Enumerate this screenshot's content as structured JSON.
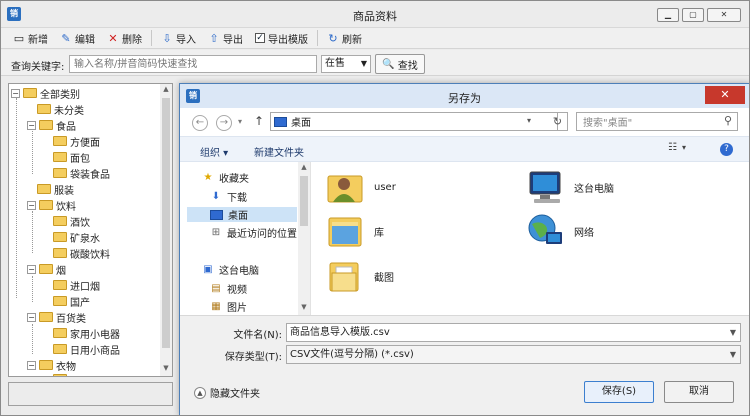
{
  "app": {
    "icon_text": "销",
    "title": "商品资料"
  },
  "toolbar": [
    {
      "label": "新增",
      "icon": "new-doc-icon"
    },
    {
      "label": "编辑",
      "icon": "pencil-icon"
    },
    {
      "label": "删除",
      "icon": "delete-x-icon"
    },
    {
      "label": "导入",
      "icon": "import-icon"
    },
    {
      "label": "导出",
      "icon": "export-icon"
    },
    {
      "label": "导出模版",
      "icon": "checkbox-icon"
    },
    {
      "label": "刷新",
      "icon": "refresh-icon"
    }
  ],
  "search": {
    "label": "查询关键字:",
    "placeholder": "输入名称/拼音简码快速查找",
    "status_value": "在售",
    "button": "查找"
  },
  "tree": [
    "全部类别",
    "未分类",
    "食品",
    "方便面",
    "面包",
    "袋装食品",
    "服装",
    "饮料",
    "酒饮",
    "矿泉水",
    "碳酸饮料",
    "烟",
    "进口烟",
    "国产",
    "百货类",
    "家用小电器",
    "日用小商品",
    "衣物",
    "…"
  ],
  "dialog": {
    "icon_text": "销",
    "title": "另存为",
    "address": "桌面",
    "search_placeholder": "搜索\"桌面\"",
    "organize": "组织",
    "new_folder": "新建文件夹",
    "nav": [
      {
        "label": "收藏夹",
        "icon": "star-icon"
      },
      {
        "label": "下载",
        "icon": "download-icon"
      },
      {
        "label": "桌面",
        "icon": "desktop-icon"
      },
      {
        "label": "最近访问的位置",
        "icon": "recent-icon"
      },
      {
        "label": "这台电脑",
        "icon": "computer-icon"
      },
      {
        "label": "视频",
        "icon": "video-icon"
      },
      {
        "label": "图片",
        "icon": "picture-icon"
      }
    ],
    "items": [
      {
        "label": "user",
        "icon": "user-folder-icon"
      },
      {
        "label": "这台电脑",
        "icon": "computer-icon"
      },
      {
        "label": "库",
        "icon": "library-icon"
      },
      {
        "label": "网络",
        "icon": "network-icon"
      },
      {
        "label": "截图",
        "icon": "folder-icon"
      }
    ],
    "filename_label": "文件名(N):",
    "filename": "商品信息导入模版.csv",
    "filetype_label": "保存类型(T):",
    "filetype": "CSV文件(逗号分隔) (*.csv)",
    "hide_label": "隐藏文件夹",
    "save": "保存(S)",
    "cancel": "取消"
  },
  "colors": {
    "dialog_title_bg": "#dbe7f6",
    "close_red": "#c7382c",
    "accent_blue": "#2f6ad0",
    "folder_yellow": "#f4cd5e"
  }
}
